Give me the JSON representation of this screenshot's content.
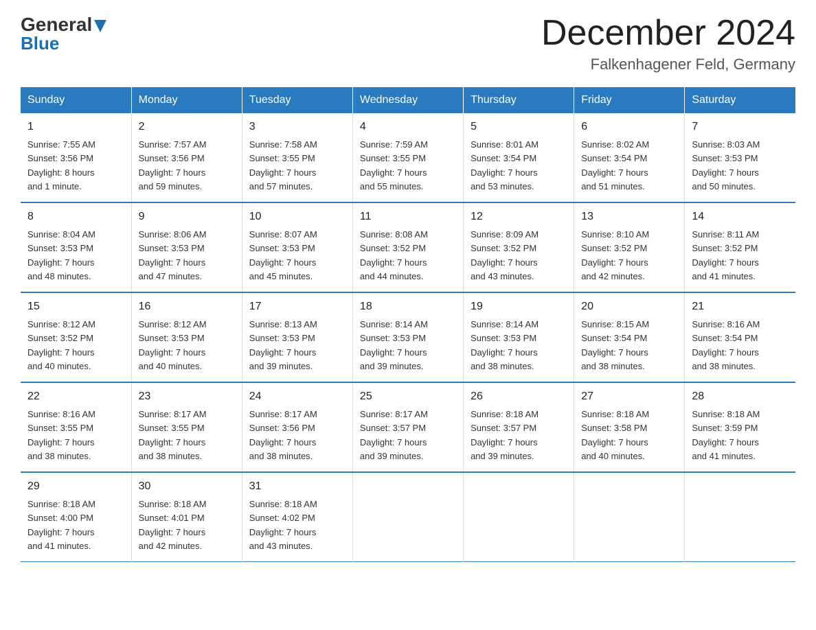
{
  "header": {
    "logo_general": "General",
    "logo_blue": "Blue",
    "month_title": "December 2024",
    "location": "Falkenhagener Feld, Germany"
  },
  "days_of_week": [
    "Sunday",
    "Monday",
    "Tuesday",
    "Wednesday",
    "Thursday",
    "Friday",
    "Saturday"
  ],
  "weeks": [
    [
      {
        "day": "1",
        "sunrise": "7:55 AM",
        "sunset": "3:56 PM",
        "daylight": "8 hours and 1 minute."
      },
      {
        "day": "2",
        "sunrise": "7:57 AM",
        "sunset": "3:56 PM",
        "daylight": "7 hours and 59 minutes."
      },
      {
        "day": "3",
        "sunrise": "7:58 AM",
        "sunset": "3:55 PM",
        "daylight": "7 hours and 57 minutes."
      },
      {
        "day": "4",
        "sunrise": "7:59 AM",
        "sunset": "3:55 PM",
        "daylight": "7 hours and 55 minutes."
      },
      {
        "day": "5",
        "sunrise": "8:01 AM",
        "sunset": "3:54 PM",
        "daylight": "7 hours and 53 minutes."
      },
      {
        "day": "6",
        "sunrise": "8:02 AM",
        "sunset": "3:54 PM",
        "daylight": "7 hours and 51 minutes."
      },
      {
        "day": "7",
        "sunrise": "8:03 AM",
        "sunset": "3:53 PM",
        "daylight": "7 hours and 50 minutes."
      }
    ],
    [
      {
        "day": "8",
        "sunrise": "8:04 AM",
        "sunset": "3:53 PM",
        "daylight": "7 hours and 48 minutes."
      },
      {
        "day": "9",
        "sunrise": "8:06 AM",
        "sunset": "3:53 PM",
        "daylight": "7 hours and 47 minutes."
      },
      {
        "day": "10",
        "sunrise": "8:07 AM",
        "sunset": "3:53 PM",
        "daylight": "7 hours and 45 minutes."
      },
      {
        "day": "11",
        "sunrise": "8:08 AM",
        "sunset": "3:52 PM",
        "daylight": "7 hours and 44 minutes."
      },
      {
        "day": "12",
        "sunrise": "8:09 AM",
        "sunset": "3:52 PM",
        "daylight": "7 hours and 43 minutes."
      },
      {
        "day": "13",
        "sunrise": "8:10 AM",
        "sunset": "3:52 PM",
        "daylight": "7 hours and 42 minutes."
      },
      {
        "day": "14",
        "sunrise": "8:11 AM",
        "sunset": "3:52 PM",
        "daylight": "7 hours and 41 minutes."
      }
    ],
    [
      {
        "day": "15",
        "sunrise": "8:12 AM",
        "sunset": "3:52 PM",
        "daylight": "7 hours and 40 minutes."
      },
      {
        "day": "16",
        "sunrise": "8:12 AM",
        "sunset": "3:53 PM",
        "daylight": "7 hours and 40 minutes."
      },
      {
        "day": "17",
        "sunrise": "8:13 AM",
        "sunset": "3:53 PM",
        "daylight": "7 hours and 39 minutes."
      },
      {
        "day": "18",
        "sunrise": "8:14 AM",
        "sunset": "3:53 PM",
        "daylight": "7 hours and 39 minutes."
      },
      {
        "day": "19",
        "sunrise": "8:14 AM",
        "sunset": "3:53 PM",
        "daylight": "7 hours and 38 minutes."
      },
      {
        "day": "20",
        "sunrise": "8:15 AM",
        "sunset": "3:54 PM",
        "daylight": "7 hours and 38 minutes."
      },
      {
        "day": "21",
        "sunrise": "8:16 AM",
        "sunset": "3:54 PM",
        "daylight": "7 hours and 38 minutes."
      }
    ],
    [
      {
        "day": "22",
        "sunrise": "8:16 AM",
        "sunset": "3:55 PM",
        "daylight": "7 hours and 38 minutes."
      },
      {
        "day": "23",
        "sunrise": "8:17 AM",
        "sunset": "3:55 PM",
        "daylight": "7 hours and 38 minutes."
      },
      {
        "day": "24",
        "sunrise": "8:17 AM",
        "sunset": "3:56 PM",
        "daylight": "7 hours and 38 minutes."
      },
      {
        "day": "25",
        "sunrise": "8:17 AM",
        "sunset": "3:57 PM",
        "daylight": "7 hours and 39 minutes."
      },
      {
        "day": "26",
        "sunrise": "8:18 AM",
        "sunset": "3:57 PM",
        "daylight": "7 hours and 39 minutes."
      },
      {
        "day": "27",
        "sunrise": "8:18 AM",
        "sunset": "3:58 PM",
        "daylight": "7 hours and 40 minutes."
      },
      {
        "day": "28",
        "sunrise": "8:18 AM",
        "sunset": "3:59 PM",
        "daylight": "7 hours and 41 minutes."
      }
    ],
    [
      {
        "day": "29",
        "sunrise": "8:18 AM",
        "sunset": "4:00 PM",
        "daylight": "7 hours and 41 minutes."
      },
      {
        "day": "30",
        "sunrise": "8:18 AM",
        "sunset": "4:01 PM",
        "daylight": "7 hours and 42 minutes."
      },
      {
        "day": "31",
        "sunrise": "8:18 AM",
        "sunset": "4:02 PM",
        "daylight": "7 hours and 43 minutes."
      },
      null,
      null,
      null,
      null
    ]
  ]
}
